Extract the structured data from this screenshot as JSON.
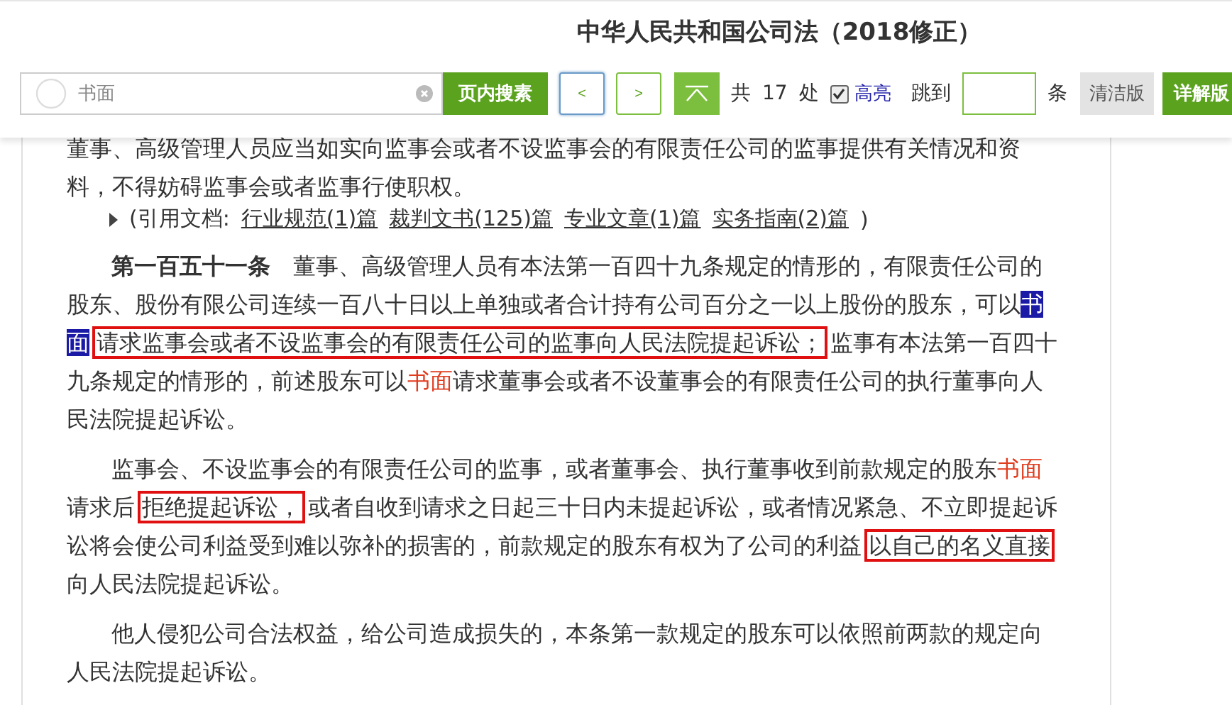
{
  "title": "中华人民共和国公司法（2018修正）",
  "toolbar": {
    "search": {
      "value": "书面"
    },
    "search_button": "页内搜素",
    "prev": "<",
    "next": ">",
    "total_prefix": "共",
    "total": "17",
    "total_suffix": "处",
    "highlight": {
      "label": "高亮",
      "checked": true
    },
    "jump_label": "跳到",
    "jump_suffix": "条",
    "versions": [
      {
        "label": "清洁版",
        "selected": false
      },
      {
        "label": "详解版",
        "selected": true
      }
    ]
  },
  "blocks": [
    {
      "kind": "text",
      "indent": false,
      "segments": [
        {
          "kind": "plain",
          "text": "董事、高级管理人员应当如实向监事会或者不设监事会的有限责任公司的监事提供有关情况和资料，不得妨碍监事会或者监事行使职权。"
        }
      ]
    },
    {
      "kind": "citations",
      "prefix": "(引用文档:",
      "links": [
        "行业规范(1)篇",
        "裁判文书(125)篇",
        "专业文章(1)篇",
        "实务指南(2)篇"
      ],
      "suffix": ")"
    },
    {
      "kind": "text",
      "indent": true,
      "segments": [
        {
          "kind": "bold",
          "text": "第一百五十一条"
        },
        {
          "kind": "plain",
          "text": "　董事、高级管理人员有本法第一百四十九条规定的情形的，有限责任公司的股东、股份有限公司连续一百八十日以上单独或者合计持有公司百分之一以上股份的股东，可以"
        },
        {
          "kind": "current",
          "text": "书面"
        },
        {
          "kind": "boxed",
          "text": "请求监事会或者不设监事会的有限责任公司的监事向人民法院提起诉讼；"
        },
        {
          "kind": "plain",
          "text": "监事有本法第一百四十九条规定的情形的，前述股东可以"
        },
        {
          "kind": "hit",
          "text": "书面"
        },
        {
          "kind": "plain",
          "text": "请求董事会或者不设董事会的有限责任公司的执行董事向人民法院提起诉讼。"
        }
      ]
    },
    {
      "kind": "text",
      "indent": true,
      "segments": [
        {
          "kind": "plain",
          "text": "监事会、不设监事会的有限责任公司的监事，或者董事会、执行董事收到前款规定的股东"
        },
        {
          "kind": "hit",
          "text": "书面"
        },
        {
          "kind": "plain",
          "text": "请求后"
        },
        {
          "kind": "boxed",
          "text": "拒绝提起诉讼，"
        },
        {
          "kind": "plain",
          "text": "或者自收到请求之日起三十日内未提起诉讼，或者情况紧急、不立即提起诉讼将会使公司利益受到难以弥补的损害的，前款规定的股东有权为了公司的利益"
        },
        {
          "kind": "boxed",
          "text": "以自己的名义直接"
        },
        {
          "kind": "plain",
          "text": "向人民法院提起诉讼。"
        }
      ]
    },
    {
      "kind": "text",
      "indent": true,
      "segments": [
        {
          "kind": "plain",
          "text": "他人侵犯公司合法权益，给公司造成损失的，本条第一款规定的股东可以依照前两款的规定向人民法院提起诉讼。"
        }
      ]
    }
  ]
}
